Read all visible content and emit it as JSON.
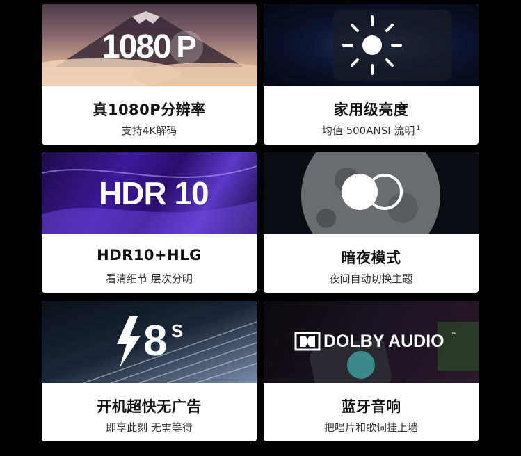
{
  "cards": [
    {
      "hero": "1080",
      "hero_badge": "P",
      "title": "真1080P分辨率",
      "subtitle": "支持4K解码"
    },
    {
      "title": "家用级亮度",
      "subtitle": "均值 500ANSI 流明",
      "subtitle_sup": "1"
    },
    {
      "hero": "HDR 10",
      "title": "HDR10+HLG",
      "subtitle": "看清细节 层次分明"
    },
    {
      "title": "暗夜模式",
      "subtitle": "夜间自动切换主题"
    },
    {
      "hero": "8",
      "hero_sup": "S",
      "title": "开机超快无广告",
      "subtitle": "即享此刻 无需等待"
    },
    {
      "hero": "DOLBY AUDIO",
      "hero_tm": "™",
      "title": "蓝牙音响",
      "subtitle": "把唱片和歌词挂上墙"
    }
  ],
  "icons": [
    "brightness-icon",
    "dark-mode-icon",
    "lightning-icon",
    "dolby-logo"
  ]
}
